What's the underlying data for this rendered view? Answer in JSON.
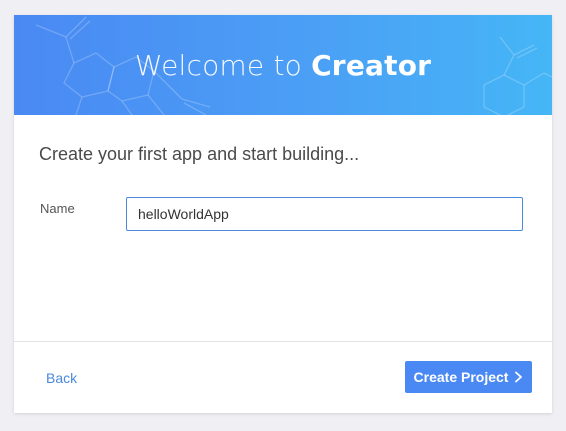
{
  "banner": {
    "title_light": "Welcome to ",
    "title_bold": "Creator",
    "gradient_start": "#4a89f3",
    "gradient_end": "#45b6f6",
    "pattern_icon": "molecule-pattern-icon"
  },
  "form": {
    "subtitle": "Create your first app and start building...",
    "name_label": "Name",
    "name_value": "helloWorldApp"
  },
  "footer": {
    "back_label": "Back",
    "create_label": "Create Project",
    "create_icon": "chevron-right-icon",
    "accent_color": "#4a89dc"
  }
}
